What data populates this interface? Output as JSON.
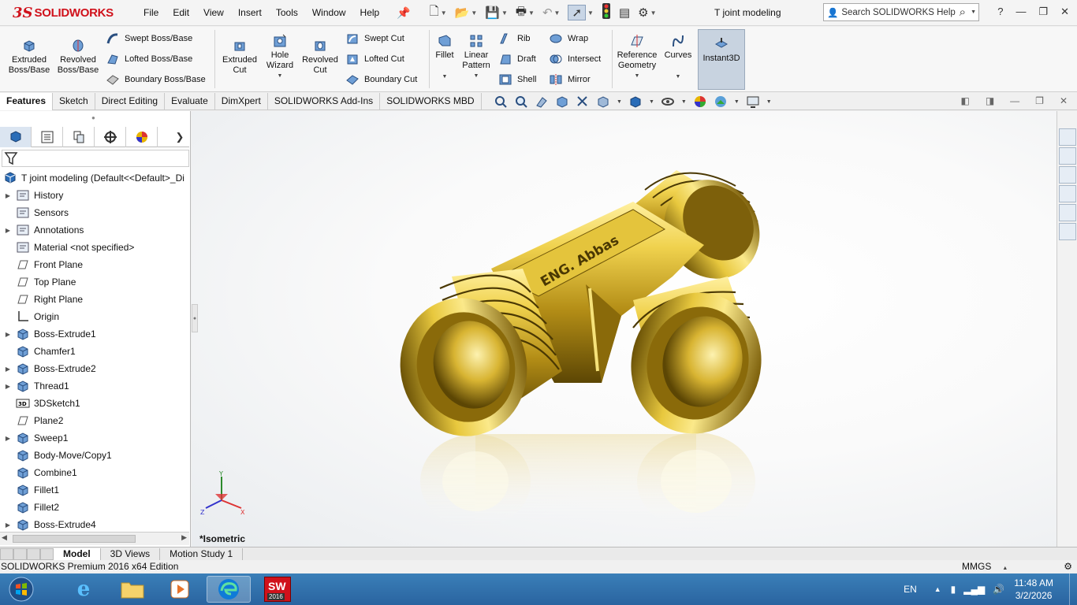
{
  "app": {
    "logo_ds": "3S",
    "logo_text": "SOLIDWORKS",
    "document_title": "T joint modeling",
    "search_placeholder": "Search SOLIDWORKS Help"
  },
  "menu": [
    "File",
    "Edit",
    "View",
    "Insert",
    "Tools",
    "Window",
    "Help"
  ],
  "ribbon": {
    "extruded_boss": "Extruded Boss/Base",
    "revolved_boss": "Revolved Boss/Base",
    "swept_boss": "Swept Boss/Base",
    "lofted_boss": "Lofted Boss/Base",
    "boundary_boss": "Boundary Boss/Base",
    "extruded_cut": "Extruded Cut",
    "hole_wizard": "Hole Wizard",
    "revolved_cut": "Revolved Cut",
    "swept_cut": "Swept Cut",
    "lofted_cut": "Lofted Cut",
    "boundary_cut": "Boundary Cut",
    "fillet": "Fillet",
    "linear_pattern": "Linear Pattern",
    "rib": "Rib",
    "draft": "Draft",
    "shell": "Shell",
    "wrap": "Wrap",
    "intersect": "Intersect",
    "mirror": "Mirror",
    "reference_geometry": "Reference Geometry",
    "curves": "Curves",
    "instant3d": "Instant3D"
  },
  "command_tabs": [
    "Features",
    "Sketch",
    "Direct Editing",
    "Evaluate",
    "DimXpert",
    "SOLIDWORKS Add-Ins",
    "SOLIDWORKS MBD"
  ],
  "feature_tree": {
    "root": "T joint modeling  (Default<<Default>_Di",
    "items": [
      {
        "label": "History",
        "expandable": true
      },
      {
        "label": "Sensors",
        "expandable": false
      },
      {
        "label": "Annotations",
        "expandable": true
      },
      {
        "label": "Material <not specified>",
        "expandable": false
      },
      {
        "label": "Front Plane",
        "expandable": false
      },
      {
        "label": "Top Plane",
        "expandable": false
      },
      {
        "label": "Right Plane",
        "expandable": false
      },
      {
        "label": "Origin",
        "expandable": false
      },
      {
        "label": "Boss-Extrude1",
        "expandable": true
      },
      {
        "label": "Chamfer1",
        "expandable": false
      },
      {
        "label": "Boss-Extrude2",
        "expandable": true
      },
      {
        "label": "Thread1",
        "expandable": true
      },
      {
        "label": "3DSketch1",
        "expandable": false
      },
      {
        "label": "Plane2",
        "expandable": false
      },
      {
        "label": "Sweep1",
        "expandable": true
      },
      {
        "label": "Body-Move/Copy1",
        "expandable": false
      },
      {
        "label": "Combine1",
        "expandable": false
      },
      {
        "label": "Fillet1",
        "expandable": false
      },
      {
        "label": "Fillet2",
        "expandable": false
      },
      {
        "label": "Boss-Extrude4",
        "expandable": true
      }
    ]
  },
  "viewport": {
    "view_name": "*Isometric",
    "engraving": "ENG. Abbas",
    "triad": {
      "x": "X",
      "y": "Y",
      "z": "Z"
    }
  },
  "model_tabs": [
    "Model",
    "3D Views",
    "Motion Study 1"
  ],
  "status": {
    "edition": "SOLIDWORKS Premium 2016 x64 Edition",
    "units": "MMGS"
  },
  "taskbar": {
    "language": "EN",
    "time": "11:48 AM",
    "date": "3/2/2026",
    "sw_badge": "SW",
    "sw_year": "2016"
  },
  "colors": {
    "brand_red": "#d0111b",
    "brass_light": "#f6e27a",
    "brass_mid": "#c9a321",
    "brass_dark": "#6b5206",
    "taskbar_blue": "#2f6ea8"
  }
}
